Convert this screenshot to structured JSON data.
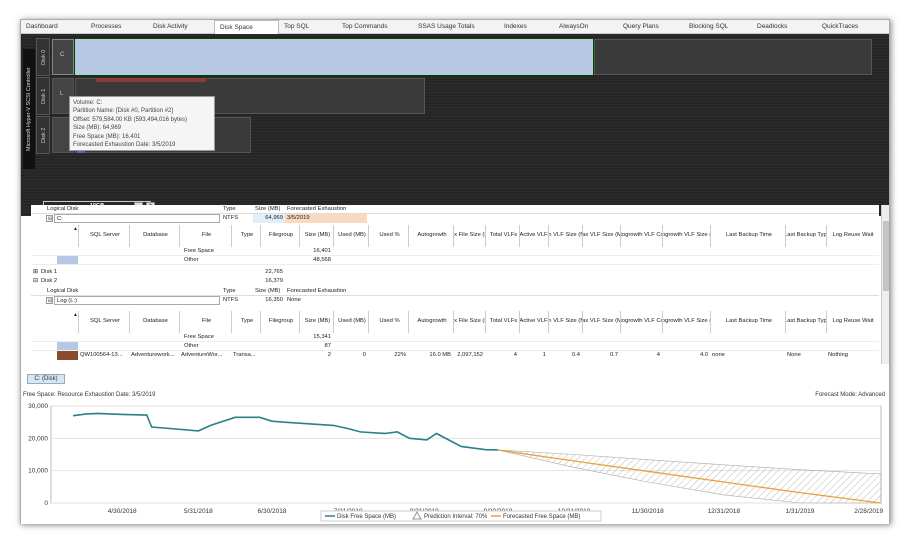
{
  "tabs": [
    "Dashboard",
    "Processes",
    "Disk Activity",
    "Disk Space",
    "Top SQL",
    "Top Commands",
    "SSAS Usage Totals",
    "Indexes",
    "AlwaysOn",
    "Query Plans",
    "Blocking SQL",
    "Deadlocks",
    "QuickTraces"
  ],
  "active_tab": "Disk Space",
  "controller_label": "Microsoft Hyper-V SCSI Controller",
  "disks": [
    "Disk 0",
    "Disk 1",
    "Disk 2"
  ],
  "partition_letters": [
    "C",
    "L"
  ],
  "tooltip": {
    "volume": "Volume: C:",
    "partition": "Partition Name: [Disk #0, Partition #2]",
    "offset": "Offset: 579,584.00 KB (593,494,016 bytes)",
    "size": "Size (MB): 64,969",
    "free": "Free Space (MB): 16,401",
    "forecast": "Forecasted Exhaustion Date: 3/5/2019"
  },
  "scale_label": "10GB",
  "zoom_minus": "-",
  "zoom_plus": "+",
  "grid": {
    "logical_header": [
      "Logical Disk",
      "Type",
      "Size (MB)",
      "Forecasted Exhaustion"
    ],
    "c_row": {
      "name": "C:",
      "type": "NTFS",
      "size": "64,969",
      "forecast": "3/5/2019"
    },
    "file_headers": [
      "SQL Server",
      "Database",
      "File",
      "Type",
      "Filegroup",
      "Size (MB)",
      "Used (MB)",
      "Used %",
      "Autogrowth",
      "Max File Size (MB)",
      "Total VLFs",
      "Active VLFs",
      "Min VLF Size (MB)",
      "Max VLF Size (MB)",
      "Autogrowth VLF Count",
      "Autogrowth VLF Size (MB)",
      "Last Backup Time",
      "Last Backup Type",
      "Log Reuse Wait"
    ],
    "c_files": [
      {
        "file": "Free Space",
        "size": "16,401"
      },
      {
        "file": "Other",
        "size": "48,568"
      }
    ],
    "disk1": {
      "name": "Disk 1",
      "size": "22,765"
    },
    "disk2": {
      "name": "Disk 2",
      "size": "16,379"
    },
    "l_row": {
      "name": "Log (L:)",
      "type": "NTFS",
      "size": "16,350",
      "forecast": "None"
    },
    "l_files": [
      {
        "file": "Free Space",
        "size": "15,341"
      },
      {
        "file": "Other",
        "size": "87"
      }
    ],
    "l_db_row": [
      "QW100564-13...",
      "Adventurework...",
      "AdventureWor...",
      "Transa...",
      "",
      "2",
      "0",
      "22%",
      "16.0 MB",
      "2,097,152",
      "4",
      "1",
      "0.4",
      "0.7",
      "4",
      "4.0",
      "none",
      "None",
      "Nothing"
    ]
  },
  "bottom": {
    "chip": "C: (Disk)",
    "chart_title": "Free Space: Resource Exhaustion Date: 3/5/2019",
    "forecast_mode": "Forecast Mode: Advanced"
  },
  "chart_data": {
    "type": "line",
    "title": "Free Space: Resource Exhaustion Date: 3/5/2019",
    "ylim": [
      0,
      30000
    ],
    "yticks": [
      "30,000",
      "20,000",
      "10,000",
      "0"
    ],
    "xticks": [
      "4/30/2018",
      "5/31/2018",
      "6/30/2018",
      "7/31/2018",
      "8/31/2018",
      "9/30/2018",
      "10/31/2018",
      "11/30/2018",
      "12/31/2018",
      "1/31/2019",
      "2/28/2019"
    ],
    "series": [
      {
        "name": "Disk Free Space (MB)",
        "color": "#2a7f8a",
        "x": [
          "4/10/2018",
          "4/15/2018",
          "4/20/2018",
          "4/30/2018",
          "5/10/2018",
          "5/12/2018",
          "5/20/2018",
          "5/31/2018",
          "6/5/2018",
          "6/15/2018",
          "6/25/2018",
          "6/30/2018",
          "7/5/2018",
          "7/15/2018",
          "7/25/2018",
          "7/31/2018",
          "8/5/2018",
          "8/15/2018",
          "8/20/2018",
          "8/25/2018",
          "9/1/2018",
          "9/5/2018",
          "9/15/2018",
          "9/25/2018",
          "9/30/2018"
        ],
        "values": [
          27000,
          27500,
          27700,
          27400,
          27200,
          23500,
          23000,
          22300,
          24000,
          26500,
          26500,
          25300,
          25000,
          24500,
          24000,
          23000,
          22000,
          21500,
          22000,
          20000,
          19500,
          21500,
          17500,
          16500,
          16400
        ]
      },
      {
        "name": "Forecasted Free Space (MB)",
        "color": "#e8a23c",
        "x": [
          "9/30/2018",
          "10/31/2018",
          "11/30/2018",
          "12/31/2018",
          "1/31/2019",
          "3/5/2019"
        ],
        "values": [
          16400,
          13000,
          9800,
          6500,
          3200,
          0
        ]
      }
    ],
    "prediction_interval": {
      "name": "Prediction Interval: 70%",
      "upper": [
        16400,
        15000,
        13400,
        11800,
        10300,
        9000
      ],
      "lower": [
        16400,
        11000,
        6500,
        2500,
        0,
        0
      ]
    },
    "legend": [
      "Disk Free Space (MB)",
      "Prediction Interval: 70%",
      "Forecasted Free Space (MB)"
    ],
    "legend_position": "bottom"
  }
}
